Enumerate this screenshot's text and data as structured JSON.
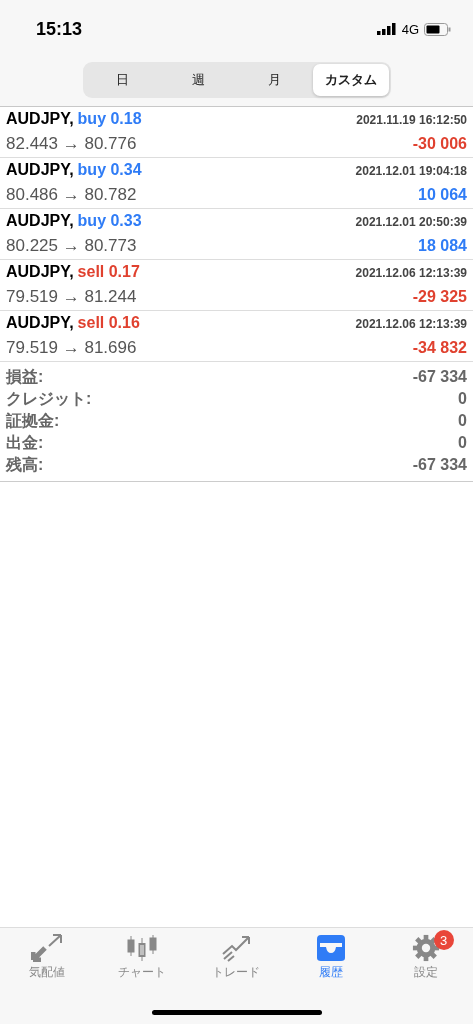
{
  "status_bar": {
    "time": "15:13",
    "network": "4G"
  },
  "period_tabs": [
    {
      "label": "日",
      "selected": false
    },
    {
      "label": "週",
      "selected": false
    },
    {
      "label": "月",
      "selected": false
    },
    {
      "label": "カスタム",
      "selected": true
    }
  ],
  "deals": [
    {
      "symbol": "AUDJPY,",
      "kind": "buy",
      "order": "buy 0.18",
      "time": "2021.11.19 16:12:50",
      "prices": "82.443 → 80.776",
      "profit": "-30 006",
      "loss": true
    },
    {
      "symbol": "AUDJPY,",
      "kind": "buy",
      "order": "buy 0.34",
      "time": "2021.12.01 19:04:18",
      "prices": "80.486 → 80.782",
      "profit": "10 064",
      "loss": false
    },
    {
      "symbol": "AUDJPY,",
      "kind": "buy",
      "order": "buy 0.33",
      "time": "2021.12.01 20:50:39",
      "prices": "80.225 → 80.773",
      "profit": "18 084",
      "loss": false
    },
    {
      "symbol": "AUDJPY,",
      "kind": "sell",
      "order": "sell 0.17",
      "time": "2021.12.06 12:13:39",
      "prices": "79.519 → 81.244",
      "profit": "-29 325",
      "loss": true
    },
    {
      "symbol": "AUDJPY,",
      "kind": "sell",
      "order": "sell 0.16",
      "time": "2021.12.06 12:13:39",
      "prices": "79.519 → 81.696",
      "profit": "-34 832",
      "loss": true
    }
  ],
  "summary": [
    {
      "label": "損益:",
      "value": "-67 334"
    },
    {
      "label": "クレジット:",
      "value": "0"
    },
    {
      "label": "証拠金:",
      "value": "0"
    },
    {
      "label": "出金:",
      "value": "0"
    },
    {
      "label": "残高:",
      "value": "-67 334"
    }
  ],
  "tab_bar": [
    {
      "kind": "quotes",
      "label": "気配値",
      "selected": false
    },
    {
      "kind": "chart",
      "label": "チャート",
      "selected": false
    },
    {
      "kind": "trade",
      "label": "トレード",
      "selected": false
    },
    {
      "kind": "history",
      "label": "履歴",
      "selected": true
    },
    {
      "kind": "settings",
      "label": "設定",
      "selected": false,
      "badge": "3"
    }
  ]
}
